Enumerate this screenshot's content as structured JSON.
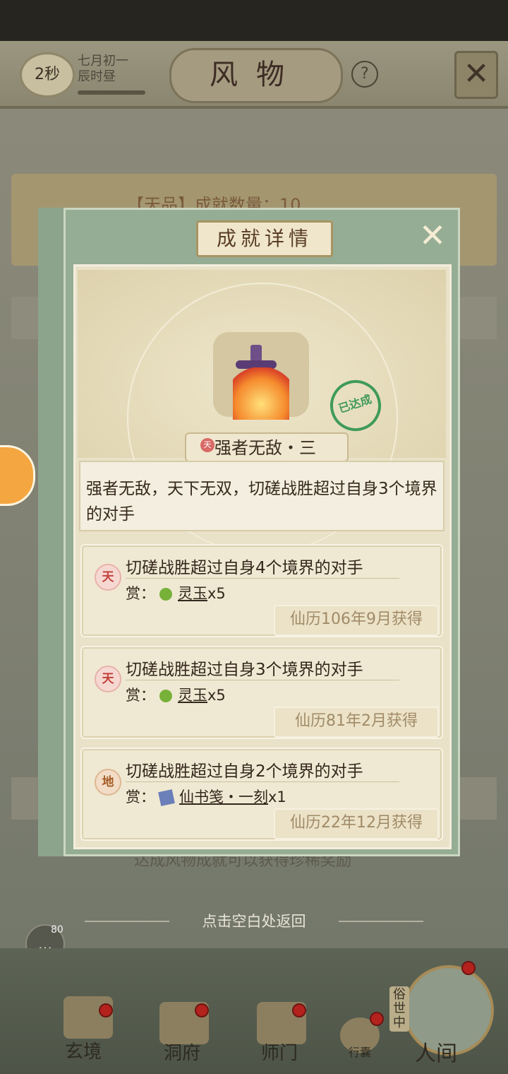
{
  "header": {
    "timer": "2秒",
    "date_line1": "七月初一",
    "date_line2": "辰时昼",
    "title": "风物",
    "help": "?"
  },
  "background": {
    "card_text": "【天品】成就数量：10",
    "footer_text": "达成风物成就可以获得珍稀奖励"
  },
  "dialog": {
    "title": "成就详情",
    "achievement_tier": "天",
    "achievement_name": "强者无敌・三",
    "stamp": "已达成",
    "description": "强者无敌，天下无双，切磋战胜超过自身3个境界的对手",
    "reward_prefix": "赏：",
    "records": [
      {
        "tier": "天",
        "title": "切磋战胜超过自身4个境界的对手",
        "item": "灵玉",
        "qty": "x5",
        "date": "仙历106年9月获得"
      },
      {
        "tier": "天",
        "title": "切磋战胜超过自身3个境界的对手",
        "item": "灵玉",
        "qty": "x5",
        "date": "仙历81年2月获得"
      },
      {
        "tier": "地",
        "title": "切磋战胜超过自身2个境界的对手",
        "item": "仙书笺・一刻",
        "qty": "x1",
        "date": "仙历22年12月获得"
      }
    ]
  },
  "return_hint": "点击空白处返回",
  "chat": {
    "count": "80"
  },
  "bottom_nav": {
    "tabs": [
      "玄境",
      "洞府",
      "师门",
      "行囊"
    ],
    "world_vertical": "俗世中",
    "world_label": "人间"
  },
  "colors": {
    "accent_green": "#95ad94",
    "red_dot": "#b3221d",
    "stamp_green": "#3f9b57"
  }
}
